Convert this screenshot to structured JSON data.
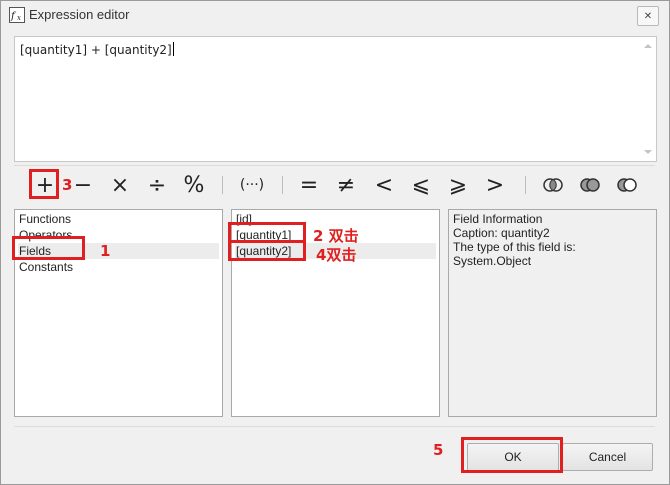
{
  "window": {
    "title": "Expression editor",
    "close_glyph": "✕"
  },
  "editor": {
    "expression": "[quantity1] + [quantity2]"
  },
  "toolbar": {
    "operators": [
      {
        "name": "plus-operator-button",
        "glyph": "+"
      },
      {
        "name": "minus-operator-button",
        "glyph": "−"
      },
      {
        "name": "multiply-operator-button",
        "glyph": "×"
      },
      {
        "name": "divide-operator-button",
        "glyph": "÷"
      },
      {
        "name": "modulo-operator-button",
        "glyph": "%"
      },
      {
        "name": "parentheses-operator-button",
        "glyph": "(···)"
      },
      {
        "name": "equals-operator-button",
        "glyph": "="
      },
      {
        "name": "not-equals-operator-button",
        "glyph": "≠"
      },
      {
        "name": "less-than-operator-button",
        "glyph": "<"
      },
      {
        "name": "less-or-equal-operator-button",
        "glyph": "⩽"
      },
      {
        "name": "greater-or-equal-operator-button",
        "glyph": "⩾"
      },
      {
        "name": "greater-than-operator-button",
        "glyph": ">"
      }
    ]
  },
  "categories": {
    "items": [
      "Functions",
      "Operators",
      "Fields",
      "Constants"
    ],
    "selected": "Fields"
  },
  "fields": {
    "items": [
      "[id]",
      "[quantity1]",
      "[quantity2]"
    ],
    "selected": "[quantity2]"
  },
  "info": {
    "lines": [
      "Field Information",
      "Caption: quantity2",
      "The type of this field is:",
      "System.Object"
    ]
  },
  "buttons": {
    "ok": "OK",
    "cancel": "Cancel"
  },
  "annotations": {
    "step1": "1",
    "step2": "2 双击",
    "step3": "3",
    "step4": "4双击",
    "step5": "5"
  },
  "colors": {
    "annotation": "#e02020"
  }
}
